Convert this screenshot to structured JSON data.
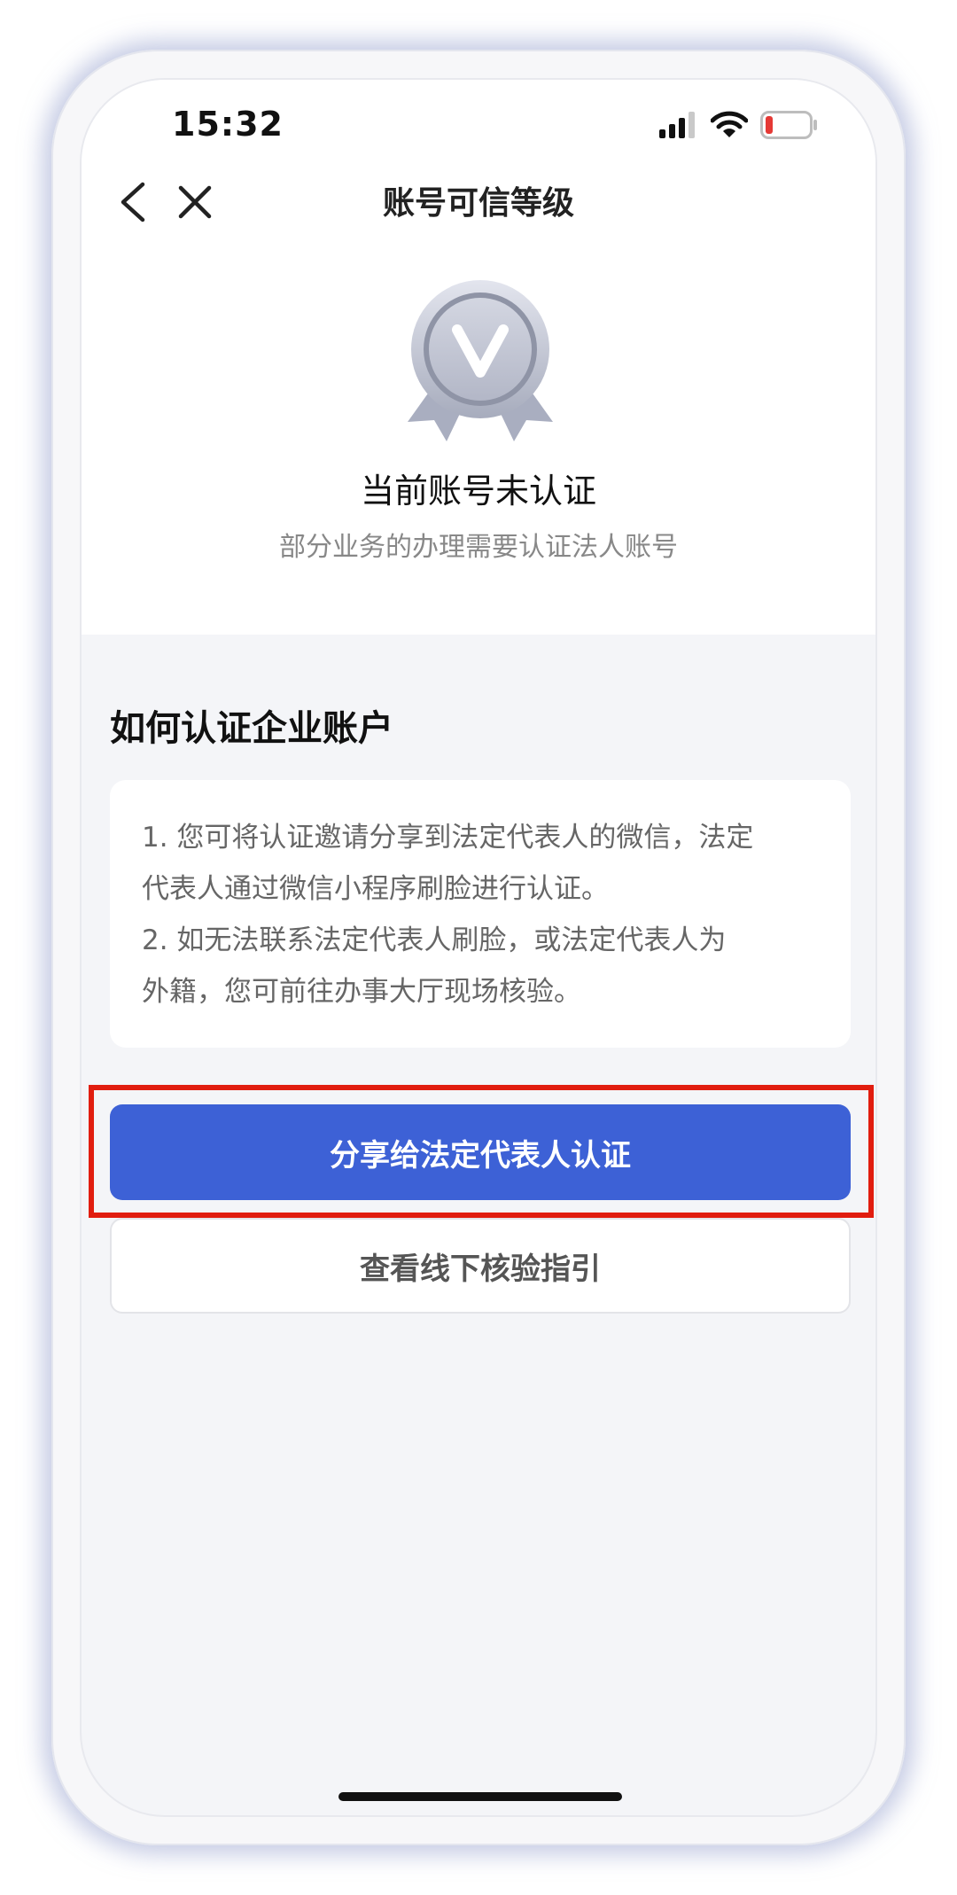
{
  "status_bar": {
    "time": "15:32",
    "icons": [
      "cellular-signal-icon",
      "wifi-icon",
      "battery-low-icon"
    ]
  },
  "nav": {
    "title": "账号可信等级",
    "back_icon": "chevron-left-icon",
    "close_icon": "close-icon"
  },
  "badge": {
    "icon": "verified-medal-icon",
    "letter": "V"
  },
  "status": {
    "title": "当前账号未认证",
    "subtitle": "部分业务的办理需要认证法人账号"
  },
  "section": {
    "title": "如何认证企业账户",
    "lines": [
      "1. 您可将认证邀请分享到法定代表人的微信，法定",
      "代表人通过微信小程序刷脸进行认证。",
      "2. 如无法联系法定代表人刷脸，或法定代表人为",
      "外籍，您可前往办事大厅现场核验。"
    ]
  },
  "buttons": {
    "primary_label": "分享给法定代表人认证",
    "secondary_label": "查看线下核验指引"
  },
  "colors": {
    "primary": "#3d61d6",
    "highlight": "#e11d0f",
    "battery_low": "#e53935"
  }
}
